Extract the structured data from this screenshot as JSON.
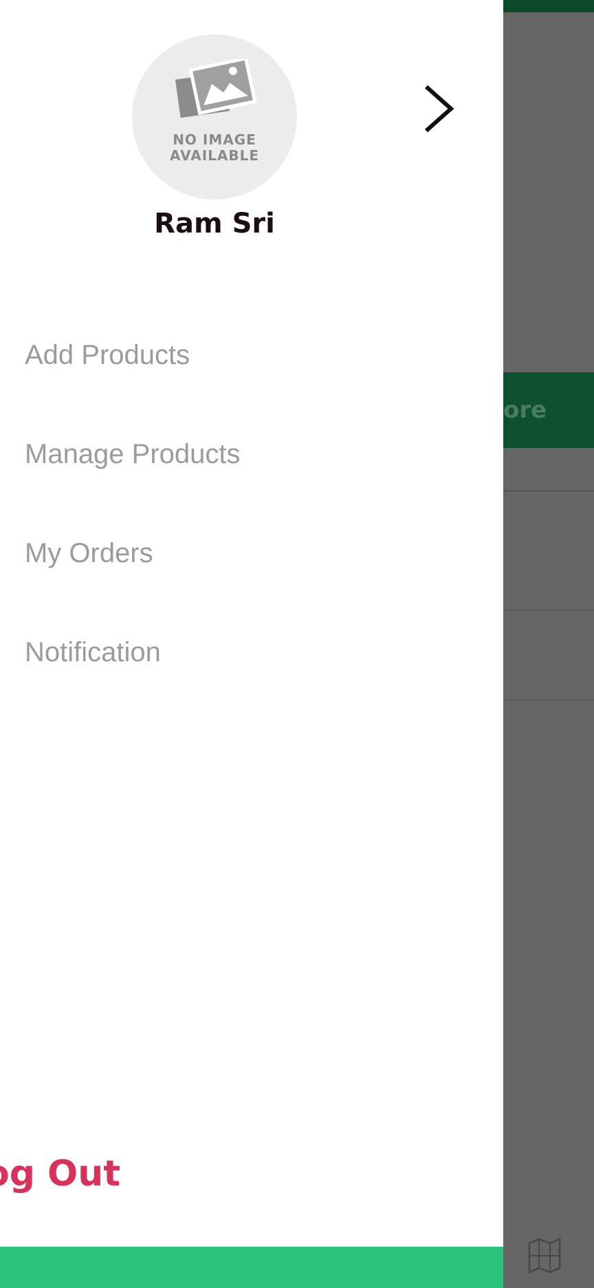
{
  "background": {
    "banner_text": "ore",
    "icons": {
      "map": "map-icon"
    },
    "colors": {
      "overlay": "#666666",
      "top_bar": "#0e4a2a",
      "banner": "#0f5030"
    }
  },
  "drawer": {
    "profile": {
      "avatar_placeholder": "NO IMAGE AVAILABLE",
      "name": "Ram Sri",
      "chevron_icon": "chevron-right-icon"
    },
    "menu": [
      {
        "label": "Add Products"
      },
      {
        "label": "Manage Products"
      },
      {
        "label": "My Orders"
      },
      {
        "label": "Notification"
      }
    ],
    "logout_label": "og Out",
    "colors": {
      "logout": "#d6325a",
      "bottom_bar": "#2bc37d",
      "menu_text": "#9b9b9b"
    }
  }
}
